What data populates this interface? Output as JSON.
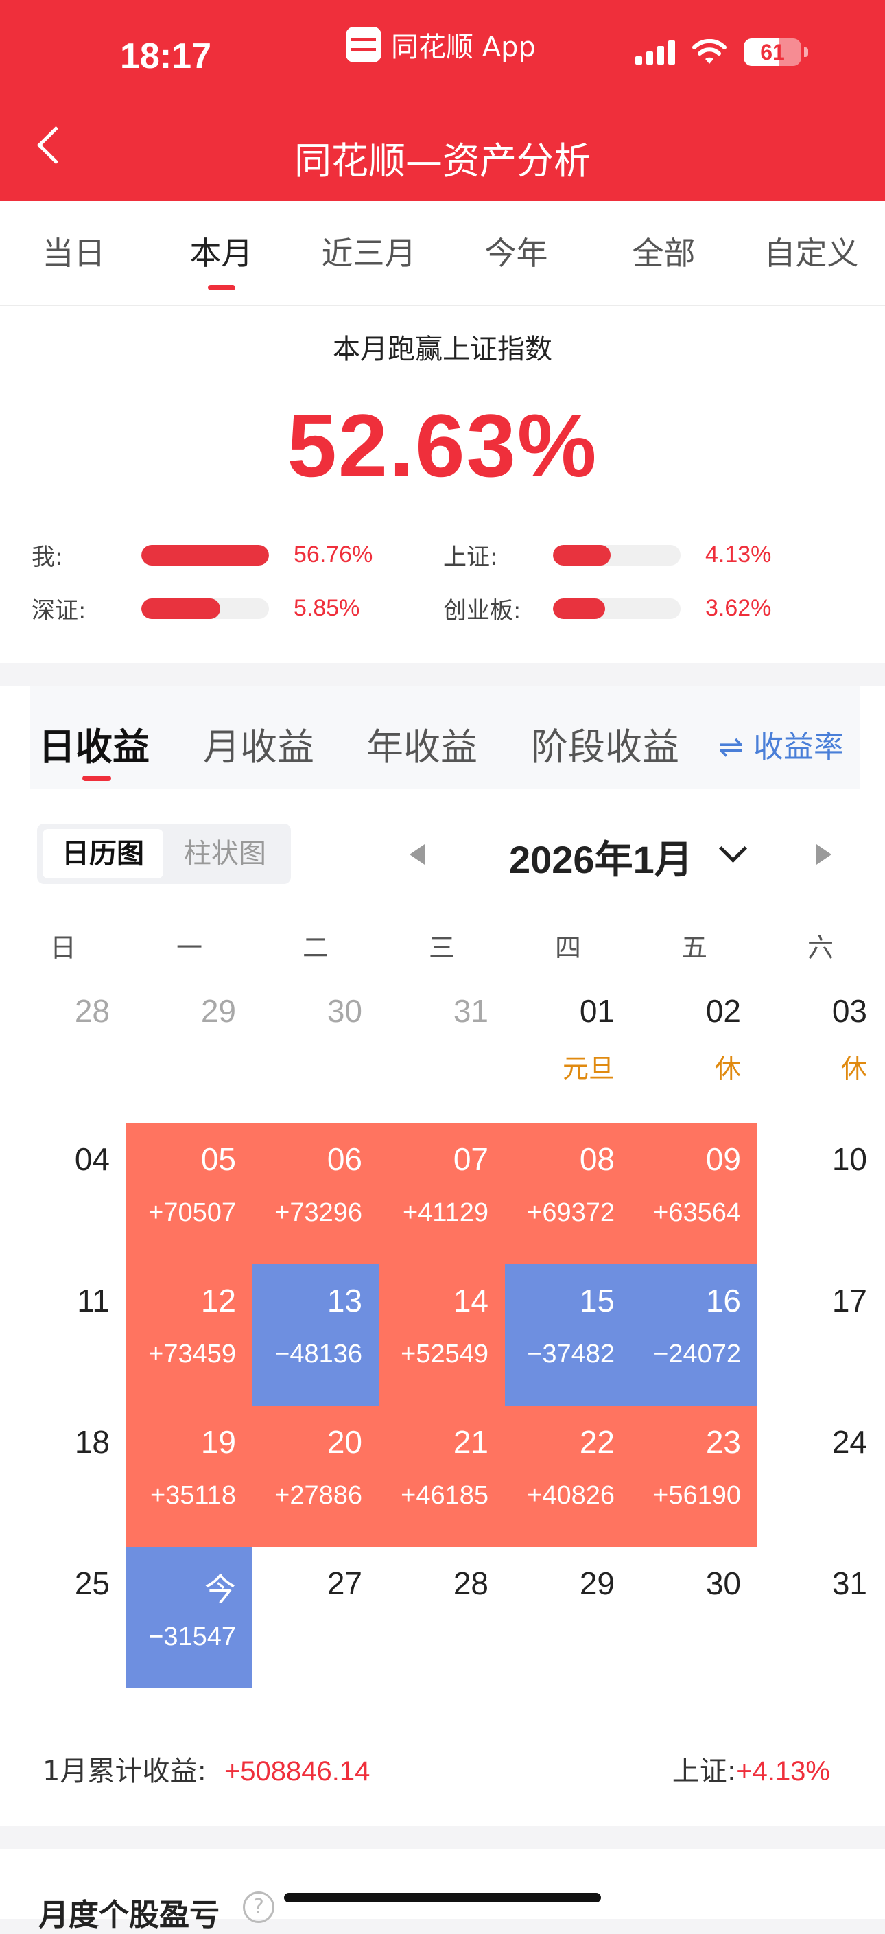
{
  "status": {
    "time": "18:17",
    "app": "同花顺 App",
    "battery": "61",
    "battery_level": 0.61
  },
  "nav": {
    "title": "同花顺—资产分析"
  },
  "tabs": [
    {
      "label": "当日",
      "active": false
    },
    {
      "label": "本月",
      "active": true
    },
    {
      "label": "近三月",
      "active": false
    },
    {
      "label": "今年",
      "active": false
    },
    {
      "label": "全部",
      "active": false
    },
    {
      "label": "自定义",
      "active": false
    }
  ],
  "summary": {
    "title": "本月跑赢上证指数",
    "percent": "52.63%",
    "bars": [
      {
        "label": "我:",
        "value": "56.76%",
        "fill": 1.0
      },
      {
        "label": "上证:",
        "value": "4.13%",
        "fill": 0.45
      },
      {
        "label": "深证:",
        "value": "5.85%",
        "fill": 0.62
      },
      {
        "label": "创业板:",
        "value": "3.62%",
        "fill": 0.41
      }
    ]
  },
  "profit_tabs": {
    "items": [
      "日收益",
      "月收益",
      "年收益",
      "阶段收益"
    ],
    "active": 0,
    "rate_link": "⇌ 收益率"
  },
  "calendar": {
    "view_toggle": {
      "on": "日历图",
      "off": "柱状图"
    },
    "month": "2026年1月",
    "weekdays": [
      "日",
      "一",
      "二",
      "三",
      "四",
      "五",
      "六"
    ],
    "weeks": [
      [
        {
          "d": "28",
          "s": "grey"
        },
        {
          "d": "29",
          "s": "grey"
        },
        {
          "d": "30",
          "s": "grey"
        },
        {
          "d": "31",
          "s": "grey"
        },
        {
          "d": "01",
          "s": "plain",
          "tag": "元旦"
        },
        {
          "d": "02",
          "s": "plain",
          "tag": "休"
        },
        {
          "d": "03",
          "s": "plain",
          "tag": "休"
        }
      ],
      [
        {
          "d": "04",
          "s": "plain"
        },
        {
          "d": "05",
          "s": "up",
          "v": "+70507"
        },
        {
          "d": "06",
          "s": "up",
          "v": "+73296"
        },
        {
          "d": "07",
          "s": "up",
          "v": "+41129"
        },
        {
          "d": "08",
          "s": "up",
          "v": "+69372"
        },
        {
          "d": "09",
          "s": "up",
          "v": "+63564"
        },
        {
          "d": "10",
          "s": "plain"
        }
      ],
      [
        {
          "d": "11",
          "s": "plain"
        },
        {
          "d": "12",
          "s": "up",
          "v": "+73459"
        },
        {
          "d": "13",
          "s": "down",
          "v": "−48136"
        },
        {
          "d": "14",
          "s": "up",
          "v": "+52549"
        },
        {
          "d": "15",
          "s": "down",
          "v": "−37482"
        },
        {
          "d": "16",
          "s": "down",
          "v": "−24072"
        },
        {
          "d": "17",
          "s": "plain"
        }
      ],
      [
        {
          "d": "18",
          "s": "plain"
        },
        {
          "d": "19",
          "s": "up",
          "v": "+35118"
        },
        {
          "d": "20",
          "s": "up",
          "v": "+27886"
        },
        {
          "d": "21",
          "s": "up",
          "v": "+46185"
        },
        {
          "d": "22",
          "s": "up",
          "v": "+40826"
        },
        {
          "d": "23",
          "s": "up",
          "v": "+56190"
        },
        {
          "d": "24",
          "s": "plain"
        }
      ],
      [
        {
          "d": "25",
          "s": "plain"
        },
        {
          "d": "今",
          "s": "down",
          "v": "−31547"
        },
        {
          "d": "27",
          "s": "plain"
        },
        {
          "d": "28",
          "s": "plain"
        },
        {
          "d": "29",
          "s": "plain"
        },
        {
          "d": "30",
          "s": "plain"
        },
        {
          "d": "31",
          "s": "plain"
        }
      ]
    ],
    "total_label": "1月累计收益:",
    "total_value": "+508846.14",
    "index_label": "上证:",
    "index_value": "+4.13%"
  },
  "bottom": {
    "title": "月度个股盈亏"
  }
}
